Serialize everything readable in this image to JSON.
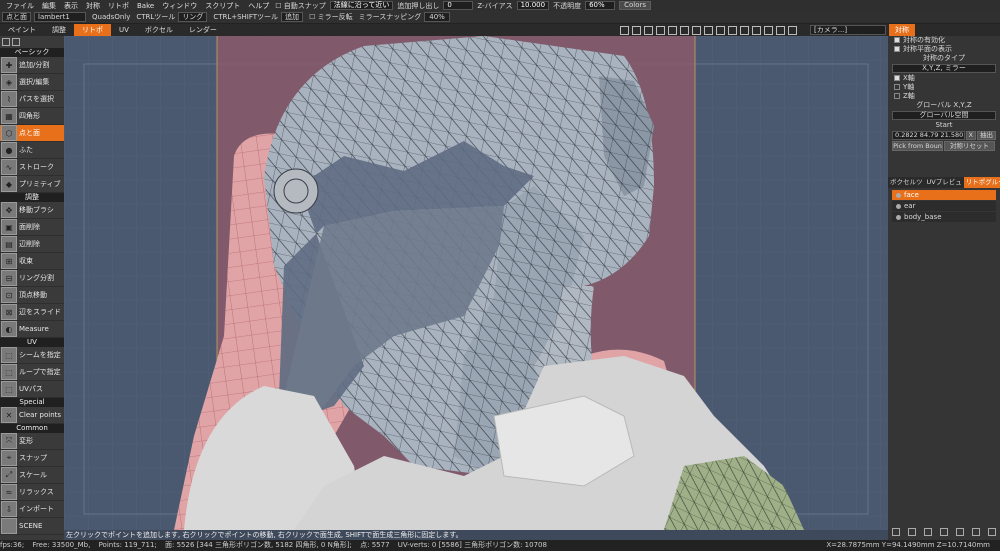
{
  "menubar": {
    "items": [
      "ファイル",
      "編集",
      "表示",
      "対称",
      "リトポ",
      "Bake",
      "ウィンドウ",
      "スクリプト",
      "ヘルプ"
    ],
    "auto_snap": "自動スナップ",
    "normal_label": "法線に沿って近い",
    "extrude_label": "追加押し出し",
    "extrude_value": "0",
    "zbias_label": "Z-バイアス",
    "zbias_value": "10.000",
    "opacity_label": "不透明度",
    "opacity_value": "60%",
    "colors_button": "Colors"
  },
  "toolbar2": {
    "tool_name": "点と面",
    "material": "lambert1",
    "quads_only": "QuadsOnly",
    "ctrl_tool_label": "CTRLツール",
    "ctrl_tool_value": "リング",
    "ctrl_shift_label": "CTRL+SHIFTツール",
    "ctrl_shift_value": "追加",
    "mirror_label": "ミラー反転",
    "mirror_snap_label": "ミラースナッピング",
    "mirror_snap_value": "40%"
  },
  "tabs": [
    {
      "label": "ペイント",
      "active": false
    },
    {
      "label": "調整",
      "active": false
    },
    {
      "label": "リトポ",
      "active": true
    },
    {
      "label": "UV",
      "active": false
    },
    {
      "label": "ボクセル",
      "active": false
    },
    {
      "label": "レンダー",
      "active": false
    }
  ],
  "camera_dropdown": "[カメラ...]",
  "right_tab": "対称",
  "sidebar": {
    "sections": [
      {
        "title": "ベーシック",
        "tools": [
          "追加/分割",
          "選択/編集",
          "パスを選択",
          "四角形",
          "点と面",
          "ふた",
          "ストローク",
          "プリミティブ"
        ]
      },
      {
        "title": "調整",
        "tools": [
          "移動ブラシ",
          "面削除",
          "辺削除",
          "収束",
          "リング分割",
          "頂点移動",
          "辺をスライド",
          "Measure"
        ]
      },
      {
        "title": "UV",
        "tools": [
          "シームを指定",
          "ループで指定",
          "UVパス"
        ]
      },
      {
        "title": "Special",
        "tools": [
          "Clear points"
        ]
      },
      {
        "title": "Common",
        "tools": [
          "変形",
          "スナップ",
          "スケール",
          "リラックス",
          "インポート"
        ]
      }
    ],
    "active_tool": "点と面",
    "scene_label": "SCENE"
  },
  "symmetry_panel": {
    "enable": "対称の有効化",
    "show_plane": "対称平面の表示",
    "type_label": "対称のタイプ",
    "type_value": "X,Y,Z, ミラー",
    "x_axis": "X軸",
    "y_axis": "Y軸",
    "z_axis": "Z軸",
    "global_label": "グローバル X,Y,Z",
    "global_dd": "グローバル空間",
    "start_label": "Start",
    "start_coords": "0.2822 84.79 21.580",
    "x_button": "X",
    "extract_button": "抽出",
    "pick_button": "Pick from Boun",
    "reset_button": "対称リセット"
  },
  "retopo_tabs": [
    "ボクセルツ",
    "UVプレビュ",
    "リトポグループ"
  ],
  "retopo_tab_active": 2,
  "layers": [
    {
      "name": "face",
      "selected": true
    },
    {
      "name": "ear",
      "selected": false
    },
    {
      "name": "body_base",
      "selected": false
    }
  ],
  "status_message": "左クリックでポイントを追加します, 右クリックでポイントの移動, 右クリックで面生成, SHIFTで面生成三角形に固定します。",
  "statusbar": {
    "fps": "fps:36;",
    "free": "Free: 33500_Mb,",
    "points": "Points: 119_711;",
    "polys": "面: 5526 [344 三角形ポリゴン数, 5182 四角形, 0 N角形];",
    "vertices": "点: 5577",
    "uv_verts": "UV-verts: 0 [5586] 三角形ポリゴン数: 10708",
    "coords": "X=28.7875mm  Y=94.1490mm  Z=10.7140mm"
  }
}
